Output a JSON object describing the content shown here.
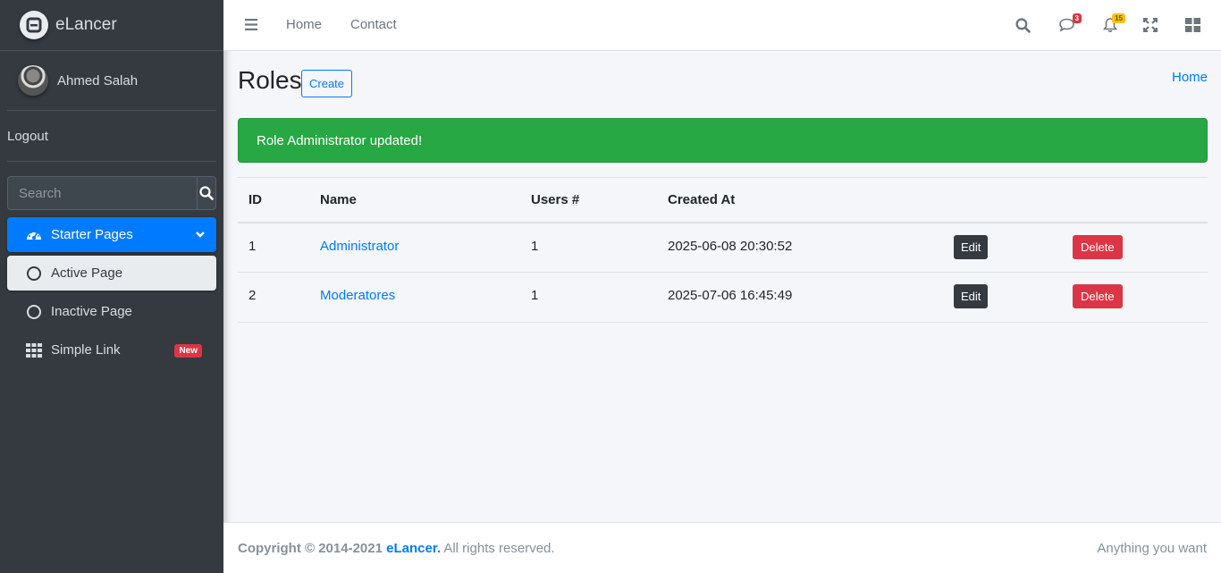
{
  "brand": {
    "name": "eLancer",
    "icon": "brand-logo-icon"
  },
  "user": {
    "name": "Ahmed Salah",
    "logout": "Logout"
  },
  "sidebar": {
    "search_placeholder": "Search",
    "items": [
      {
        "label": "Starter Pages",
        "icon": "tachometer-icon",
        "state": "active",
        "chevron": "chevron-down-icon"
      },
      {
        "label": "Active Page",
        "icon": "circle-icon",
        "state": "sub-active"
      },
      {
        "label": "Inactive Page",
        "icon": "circle-icon",
        "state": "normal"
      },
      {
        "label": "Simple Link",
        "icon": "grid-icon",
        "state": "normal",
        "badge": "New"
      }
    ]
  },
  "navbar": {
    "links": [
      "Home",
      "Contact"
    ],
    "messages_count": "3",
    "notifications_count": "15"
  },
  "page": {
    "title": "Roles",
    "create_label": "Create",
    "breadcrumb": "Home",
    "alert": "Role Administrator updated!"
  },
  "table": {
    "headers": [
      "ID",
      "Name",
      "Users #",
      "Created At"
    ],
    "rows": [
      {
        "id": "1",
        "name": "Administrator",
        "users": "1",
        "created_at": "2025-06-08 20:30:52",
        "edit": "Edit",
        "delete": "Delete"
      },
      {
        "id": "2",
        "name": "Moderatores",
        "users": "1",
        "created_at": "2025-07-06 16:45:49",
        "edit": "Edit",
        "delete": "Delete"
      }
    ]
  },
  "footer": {
    "copyright": "Copyright © 2014-2021",
    "brand": "eLancer.",
    "rights": "All rights reserved.",
    "right_text": "Anything you want"
  },
  "colors": {
    "primary": "#007bff",
    "success": "#28a745",
    "danger": "#dc3545",
    "dark": "#343a40",
    "warning": "#ffc107"
  }
}
